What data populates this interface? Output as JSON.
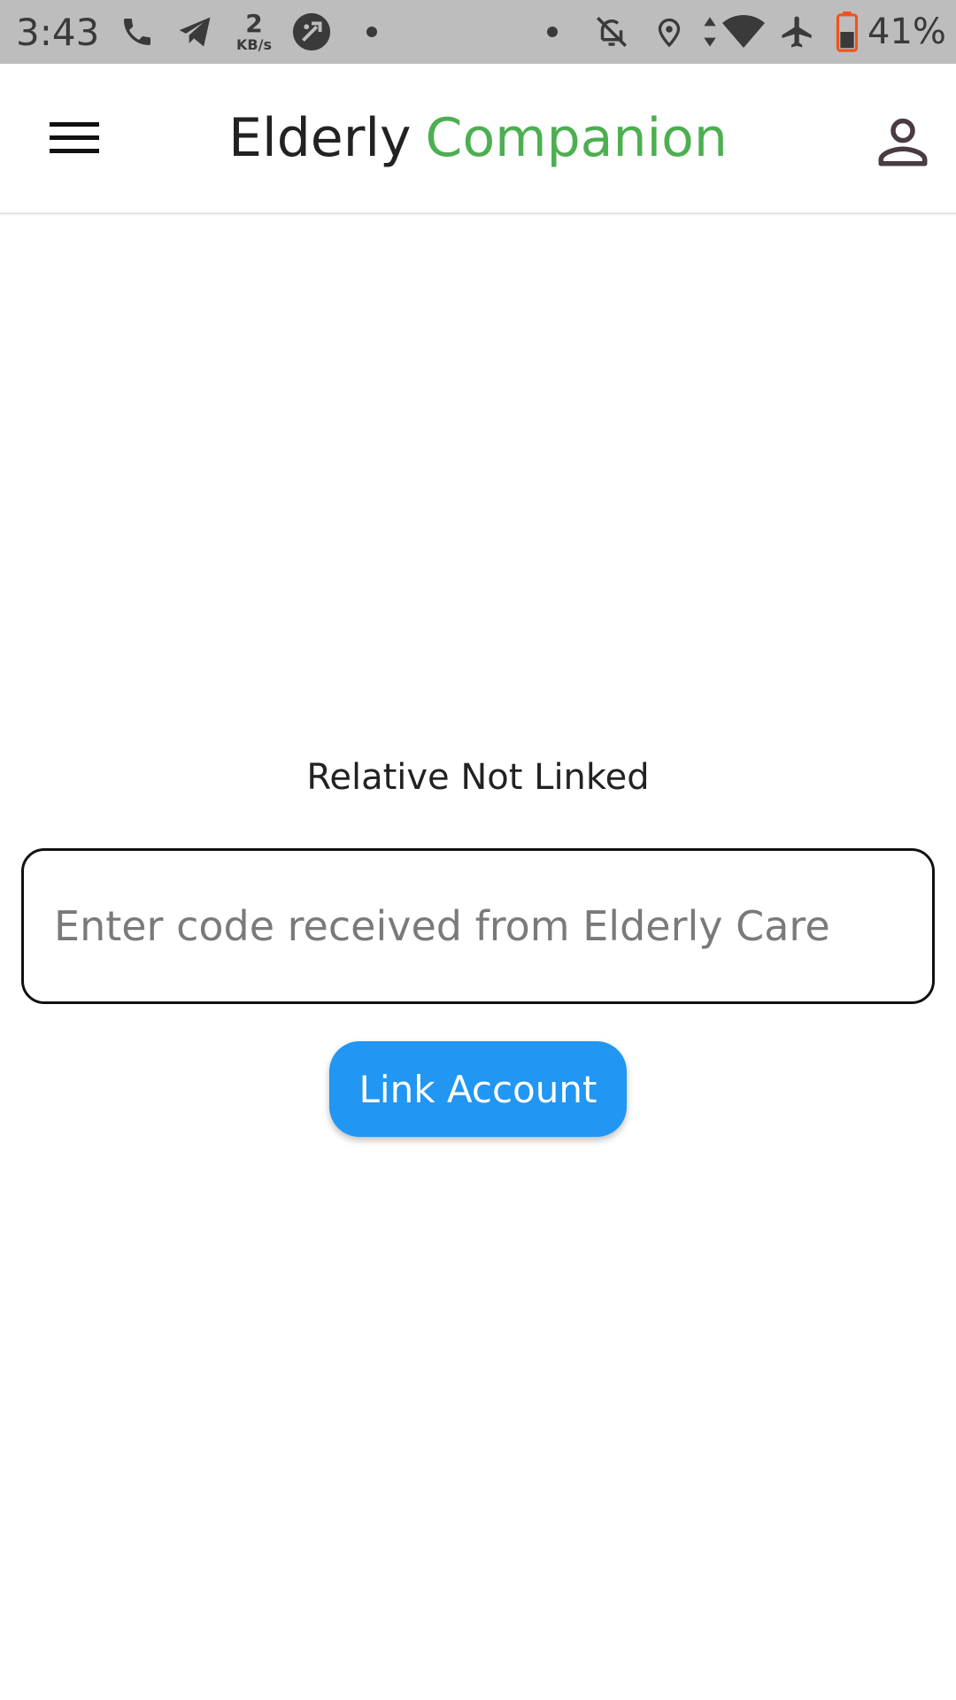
{
  "status_bar": {
    "time": "3:43",
    "net_speed_value": "2",
    "net_speed_unit": "KB/s",
    "battery_percent": "41%",
    "icons": [
      "phone-icon",
      "telegram-icon",
      "speed-icon",
      "app-icon",
      "dot-icon",
      "dot-icon",
      "notifications-off-icon",
      "location-icon",
      "data-arrows-icon",
      "wifi-icon",
      "airplane-icon",
      "battery-icon"
    ]
  },
  "app_bar": {
    "title_part1": "Elderly",
    "title_part2": "Companion",
    "menu_icon": "menu-icon",
    "profile_icon": "person-icon"
  },
  "main": {
    "status_text": "Relative Not Linked",
    "code_input": {
      "value": "",
      "placeholder": "Enter code received from Elderly Care"
    },
    "link_button_label": "Link Account"
  },
  "colors": {
    "accent_green": "#4caf50",
    "button_blue": "#2196f3",
    "status_bar_bg": "#bdbdbd",
    "battery_orange": "#f4511e"
  }
}
